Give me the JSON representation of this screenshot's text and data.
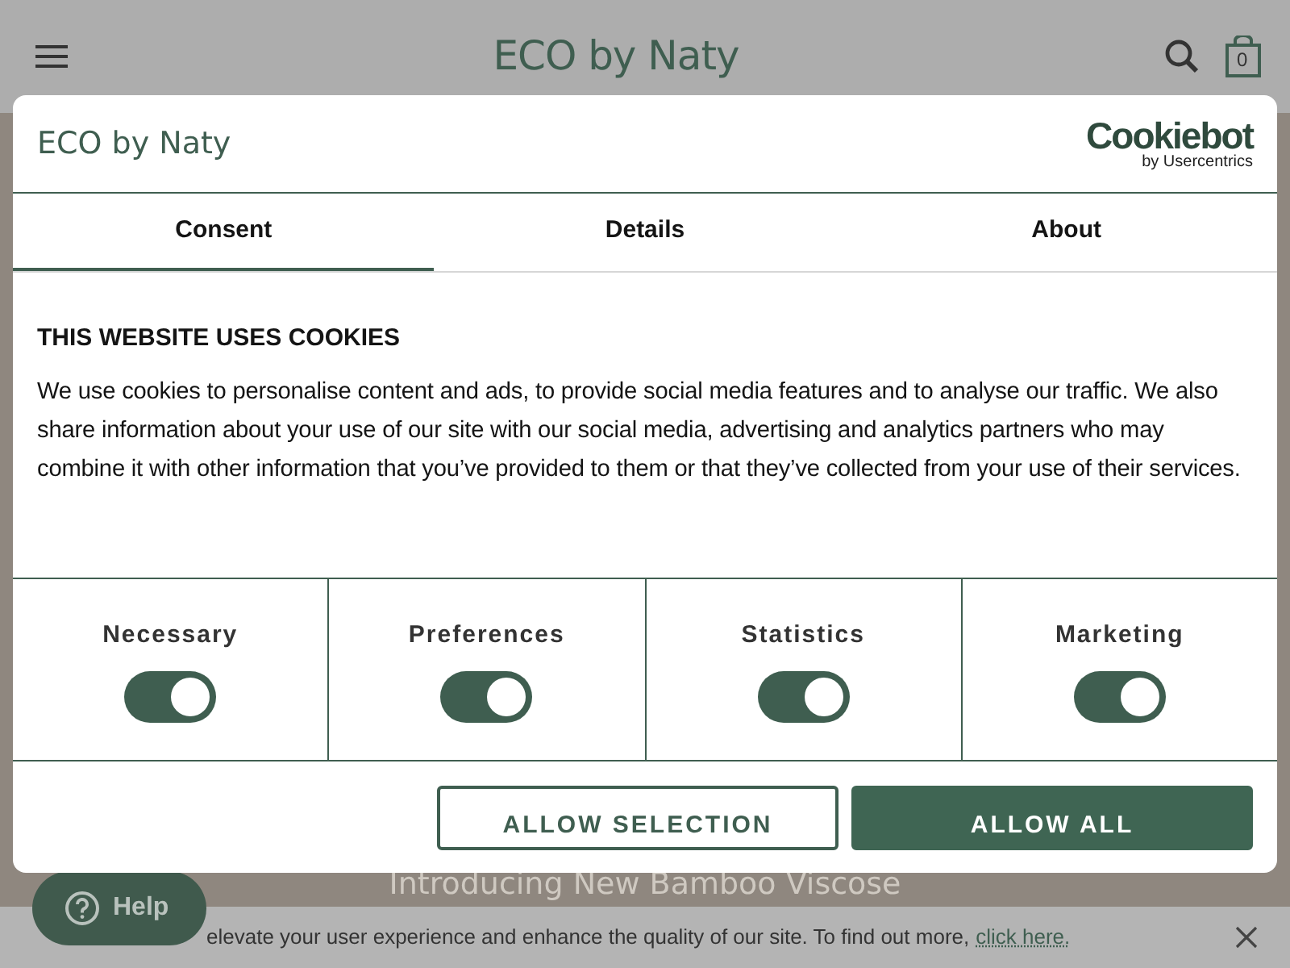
{
  "header": {
    "logo": "ECO by Naty",
    "cart_count": "0"
  },
  "hero": {
    "title": "Introducing New Bamboo Viscose"
  },
  "help_button": {
    "label": "Help"
  },
  "notice_bar": {
    "text": "elevate your user experience and enhance the quality of our site. To find out more,",
    "link": "click here."
  },
  "dialog": {
    "logo": "ECO by Naty",
    "provider": "Cookiebot",
    "provider_sub": "by Usercentrics",
    "tabs": [
      {
        "label": "Consent",
        "selected": true
      },
      {
        "label": "Details",
        "selected": false
      },
      {
        "label": "About",
        "selected": false
      }
    ],
    "heading": "THIS WEBSITE USES COOKIES",
    "body": "We use cookies to personalise content and ads, to provide social media features and to analyse our traffic. We also share information about your use of our site with our social media, advertising and analytics partners who may combine it with other information that you’ve provided to them or that they’ve collected from your use of their services.",
    "categories": [
      {
        "label": "Necessary",
        "checked": true
      },
      {
        "label": "Preferences",
        "checked": true
      },
      {
        "label": "Statistics",
        "checked": true
      },
      {
        "label": "Marketing",
        "checked": true
      }
    ],
    "buttons": [
      {
        "label": "ALLOW SELECTION",
        "kind": "outline"
      },
      {
        "label": "ALLOW ALL",
        "kind": "primary"
      }
    ]
  }
}
